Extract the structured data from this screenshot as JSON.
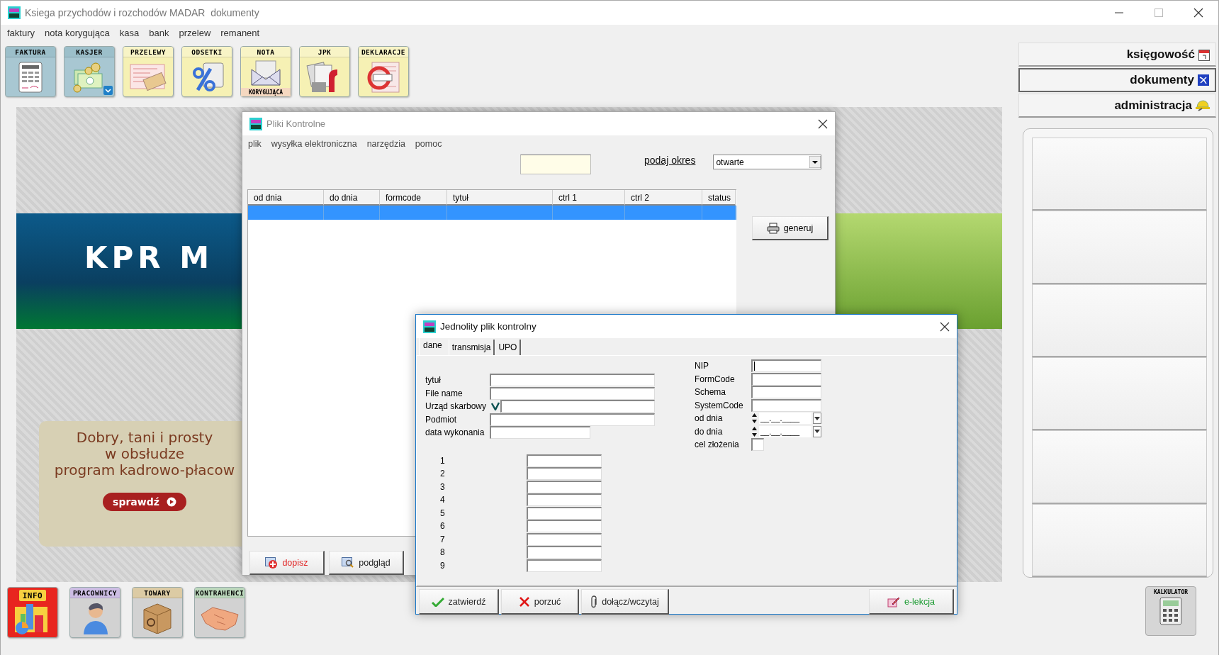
{
  "window": {
    "title": "Ksiega przychodów i rozchodów MADAR  dokumenty"
  },
  "menu": [
    "faktury",
    "nota korygująca",
    "kasa",
    "bank",
    "przelew",
    "remanent"
  ],
  "toolbar": [
    {
      "label": "FAKTURA",
      "kind": "blue",
      "has_menu": false
    },
    {
      "label": "KASJER",
      "kind": "blue",
      "has_menu": true
    },
    {
      "label": "PRZELEWY",
      "kind": "yellow",
      "has_menu": false
    },
    {
      "label": "ODSETKI",
      "kind": "yellow",
      "has_menu": false
    },
    {
      "label": "NOTA",
      "sublabel": "KORYGUJĄCA",
      "kind": "yellow",
      "has_menu": false
    },
    {
      "label": "JPK",
      "kind": "yellow",
      "has_menu": false
    },
    {
      "label": "DEKLARACJE",
      "kind": "yellow",
      "has_menu": false
    }
  ],
  "nav": [
    {
      "label": "księgowość",
      "selected": false
    },
    {
      "label": "dokumenty",
      "selected": true
    },
    {
      "label": "administracja",
      "selected": false
    }
  ],
  "banner": {
    "headline": "KPR M",
    "lines": [
      "Dobry, tani i prosty",
      "w obsłudze",
      "program kadrowo-płacow"
    ],
    "button": "sprawdź"
  },
  "bottom_toolbar": [
    {
      "label": "INFO",
      "kind": "red"
    },
    {
      "label": "PRACOWNICY",
      "kind": "purple"
    },
    {
      "label": "TOWARY",
      "kind": "tan"
    },
    {
      "label": "KONTRAHENCI",
      "kind": "green"
    }
  ],
  "calculator": {
    "label": "KALKULATOR"
  },
  "pliki": {
    "title": "Pliki Kontrolne",
    "menu": [
      "plik",
      "wysyłka elektroniczna",
      "narzędzia",
      "pomoc"
    ],
    "period_link": "podaj okres",
    "status": "otwarte",
    "table": {
      "columns": [
        "od dnia",
        "do dnia",
        "formcode",
        "tytuł",
        "ctrl 1",
        "ctrl 2",
        "status"
      ],
      "rows": [
        {
          "selected": true
        }
      ]
    },
    "generate_button": "generuj",
    "buttons": [
      {
        "label": "dopisz",
        "kind": "add"
      },
      {
        "label": "podgląd",
        "kind": "preview"
      }
    ]
  },
  "jpk": {
    "title": "Jednolity plik kontrolny",
    "tabs": [
      {
        "label": "dane",
        "selected": true
      },
      {
        "label": "transmisja",
        "selected": false
      },
      {
        "label": "UPO",
        "selected": false
      }
    ],
    "fields": [
      {
        "label": "tytuł",
        "kind": "text"
      },
      {
        "label": "File name",
        "kind": "text"
      },
      {
        "label": "Urząd skarbowy",
        "kind": "picker"
      },
      {
        "label": "Podmiot",
        "kind": "text"
      },
      {
        "label": "data wykonania",
        "kind": "short"
      }
    ],
    "numbered_fields": [
      "1",
      "2",
      "3",
      "4",
      "5",
      "6",
      "7",
      "8",
      "9"
    ],
    "right_fields": [
      {
        "label": "NIP",
        "kind": "text",
        "focused": true
      },
      {
        "label": "FormCode",
        "kind": "text",
        "focused": false
      },
      {
        "label": "Schema",
        "kind": "text",
        "focused": false
      },
      {
        "label": "SystemCode",
        "kind": "text",
        "focused": false
      },
      {
        "label": "od dnia",
        "kind": "date",
        "value": "__.__.____",
        "focused": false
      },
      {
        "label": "do dnia",
        "kind": "date",
        "value": "__.__.____",
        "focused": false
      },
      {
        "label": "cel złożenia",
        "kind": "tiny",
        "focused": false
      }
    ],
    "buttons": [
      {
        "label": "zatwierdź",
        "kind": "confirm"
      },
      {
        "label": "porzuć",
        "kind": "cancel"
      },
      {
        "label": "dołącz/wczytaj",
        "kind": "attach"
      }
    ],
    "help_button": "e-lekcja"
  }
}
